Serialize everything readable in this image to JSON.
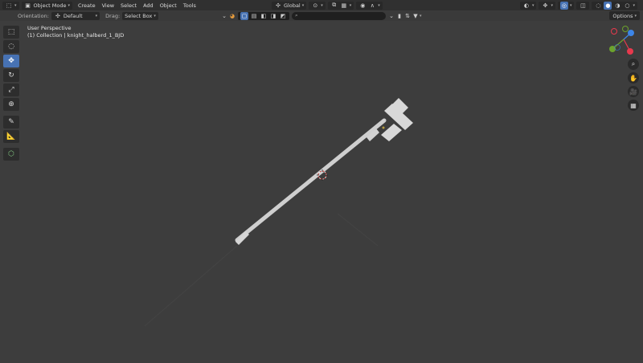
{
  "header": {
    "editor_icon": "3d-viewport-icon",
    "mode": "Object Mode",
    "menus": [
      "Create",
      "View",
      "Select",
      "Add",
      "Object",
      "Tools"
    ],
    "transform_orientation": "Global",
    "options_label": "Options"
  },
  "toolsettings": {
    "orientation_label": "Orientation:",
    "orientation_value": "Default",
    "drag_label": "Drag:",
    "drag_value": "Select Box",
    "search_placeholder": ""
  },
  "viewport": {
    "perspective": "User Perspective",
    "collection_text": "(1) Collection | knight_halberd_1_BJD"
  },
  "gizmo": {
    "x_color": "#e8394d",
    "y_color": "#6ca22d",
    "z_color": "#3d86e8"
  },
  "toolbar_icons": [
    "select-box-icon",
    "cursor-icon",
    "move-icon",
    "rotate-icon",
    "scale-icon",
    "transform-icon",
    "annotate-icon",
    "measure-icon",
    "add-cube-icon"
  ],
  "nav_icons": [
    "zoom-icon",
    "pan-hand-icon",
    "camera-icon",
    "grid-view-icon"
  ],
  "colors": {
    "background": "#3d3d3d",
    "header": "#303030",
    "accent": "#4772b3",
    "object": "#cfcfcf"
  }
}
